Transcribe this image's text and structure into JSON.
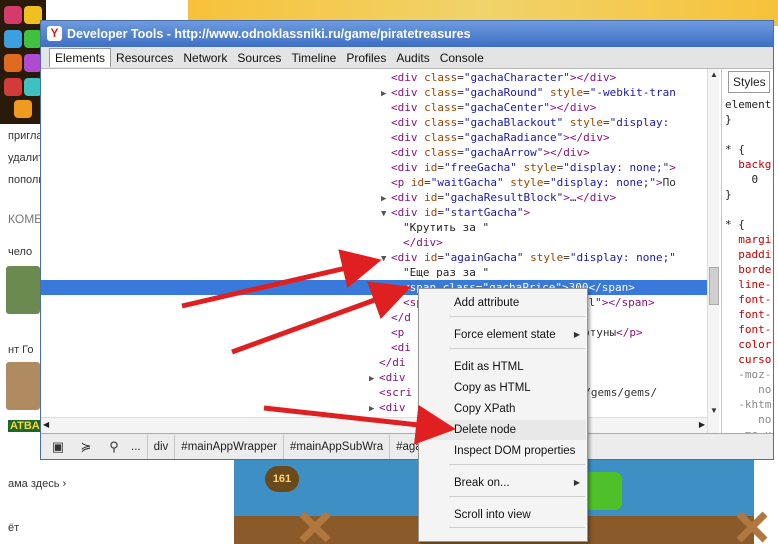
{
  "window": {
    "title": "Developer Tools - http://www.odnoklassniki.ru/game/piratetreasures",
    "tabs": [
      "Elements",
      "Resources",
      "Network",
      "Sources",
      "Timeline",
      "Profiles",
      "Audits",
      "Console"
    ],
    "active_tab": "Elements"
  },
  "elements_tree": [
    {
      "tri": "",
      "indent": 0,
      "html": "<div class=\"gachaCharacter\"></div>"
    },
    {
      "tri": "▶",
      "indent": 0,
      "html": "<div class=\"gachaRound\" style=\"-webkit-tran"
    },
    {
      "tri": "",
      "indent": 0,
      "html": "<div class=\"gachaCenter\"></div>"
    },
    {
      "tri": "",
      "indent": 0,
      "html": "<div class=\"gachaBlackout\" style=\"display: "
    },
    {
      "tri": "",
      "indent": 0,
      "html": "<div class=\"gachaRadiance\"></div>"
    },
    {
      "tri": "",
      "indent": 0,
      "html": "<div class=\"gachaArrow\"></div>"
    },
    {
      "tri": "",
      "indent": 0,
      "html": "<div id=\"freeGacha\" style=\"display: none;\">"
    },
    {
      "tri": "",
      "indent": 0,
      "html": "<p id=\"waitGacha\" style=\"display: none;\">По"
    },
    {
      "tri": "▶",
      "indent": 0,
      "html": "<div id=\"gachaResultBlock\">…</div>"
    },
    {
      "tri": "▼",
      "indent": 0,
      "html": "<div id=\"startGacha\">"
    },
    {
      "tri": "",
      "indent": 1,
      "html": "\"Крутить за \""
    },
    {
      "tri": "",
      "indent": 1,
      "html": "</div>"
    },
    {
      "tri": "▼",
      "indent": 0,
      "html": "<div id=\"againGacha\" style=\"display: none;\""
    },
    {
      "tri": "",
      "indent": 1,
      "html": "\"Еще раз за \""
    },
    {
      "tri": "",
      "indent": 1,
      "html": "<span class=\"gachaPrice\">300</span>",
      "selected": true
    },
    {
      "tri": "",
      "indent": 1,
      "html": "<sp                       all\"></span>"
    },
    {
      "tri": "",
      "indent": 0,
      "html": "</d"
    },
    {
      "tri": "",
      "indent": 0,
      "html": "<p                      со Фортуны</p>"
    },
    {
      "tri": "",
      "indent": 0,
      "html": "<di"
    },
    {
      "tri": "",
      "indent": -1,
      "html": "</di"
    },
    {
      "tri": "▶",
      "indent": -1,
      "html": "<div"
    },
    {
      "tri": "",
      "indent": -1,
      "html": "<scri                     05.65/gems/gems/"
    },
    {
      "tri": "▶",
      "indent": -1,
      "html": "<div                     /div>"
    },
    {
      "tri": "▶",
      "indent": -1,
      "html": "<div"
    }
  ],
  "styles": {
    "tab_label": "Styles",
    "lines": [
      {
        "t": "element",
        "c": "n"
      },
      {
        "t": "}",
        "c": "n"
      },
      {
        "t": "",
        "c": "n"
      },
      {
        "t": "* {",
        "c": "n"
      },
      {
        "t": "  backg",
        "c": "p"
      },
      {
        "t": "    0",
        "c": "n"
      },
      {
        "t": "}",
        "c": "n"
      },
      {
        "t": "",
        "c": "n"
      },
      {
        "t": "* {",
        "c": "n"
      },
      {
        "t": "  margi",
        "c": "p"
      },
      {
        "t": "  paddi",
        "c": "p"
      },
      {
        "t": "  borde",
        "c": "p"
      },
      {
        "t": "  line-",
        "c": "p"
      },
      {
        "t": "  font-",
        "c": "p"
      },
      {
        "t": "  font-",
        "c": "p"
      },
      {
        "t": "  font-",
        "c": "p"
      },
      {
        "t": "  color",
        "c": "p"
      },
      {
        "t": "  curso",
        "c": "p"
      },
      {
        "t": "  -moz-",
        "c": "d"
      },
      {
        "t": "     no",
        "c": "d"
      },
      {
        "t": "  -khtm",
        "c": "d"
      },
      {
        "t": "     no",
        "c": "d"
      },
      {
        "t": "  -ms-u",
        "c": "d"
      },
      {
        "t": "  -o-us",
        "c": "d"
      }
    ]
  },
  "breadcrumbs": [
    "...",
    "div",
    "#mainAppWrapper",
    "#mainAppSubWra",
    "#againGacha",
    "span.gachaPrice"
  ],
  "breadcrumb_active": "span.gachaPrice",
  "context_menu": {
    "items": [
      {
        "label": "Add attribute",
        "submenu": false
      },
      {
        "label": "Force element state",
        "submenu": true
      },
      {
        "label": "Edit as HTML",
        "submenu": false
      },
      {
        "label": "Copy as HTML",
        "submenu": false
      },
      {
        "label": "Copy XPath",
        "submenu": false
      },
      {
        "label": "Delete node",
        "submenu": false,
        "hover": true
      },
      {
        "label": "Inspect DOM properties",
        "submenu": false
      },
      {
        "label": "Break on...",
        "submenu": true
      },
      {
        "label": "Scroll into view",
        "submenu": false
      }
    ]
  },
  "background_page": {
    "side_texts": [
      "пригла",
      "удалит",
      "пополн",
      "КОМЕ",
      "чело",
      "нт Го",
      "ATBA",
      "ама здесь ›",
      "ёт"
    ],
    "game_badge": "161"
  },
  "colors": {
    "selection": "#3879d9",
    "arrow": "#e02020",
    "title_bar": "#4a78c8"
  }
}
